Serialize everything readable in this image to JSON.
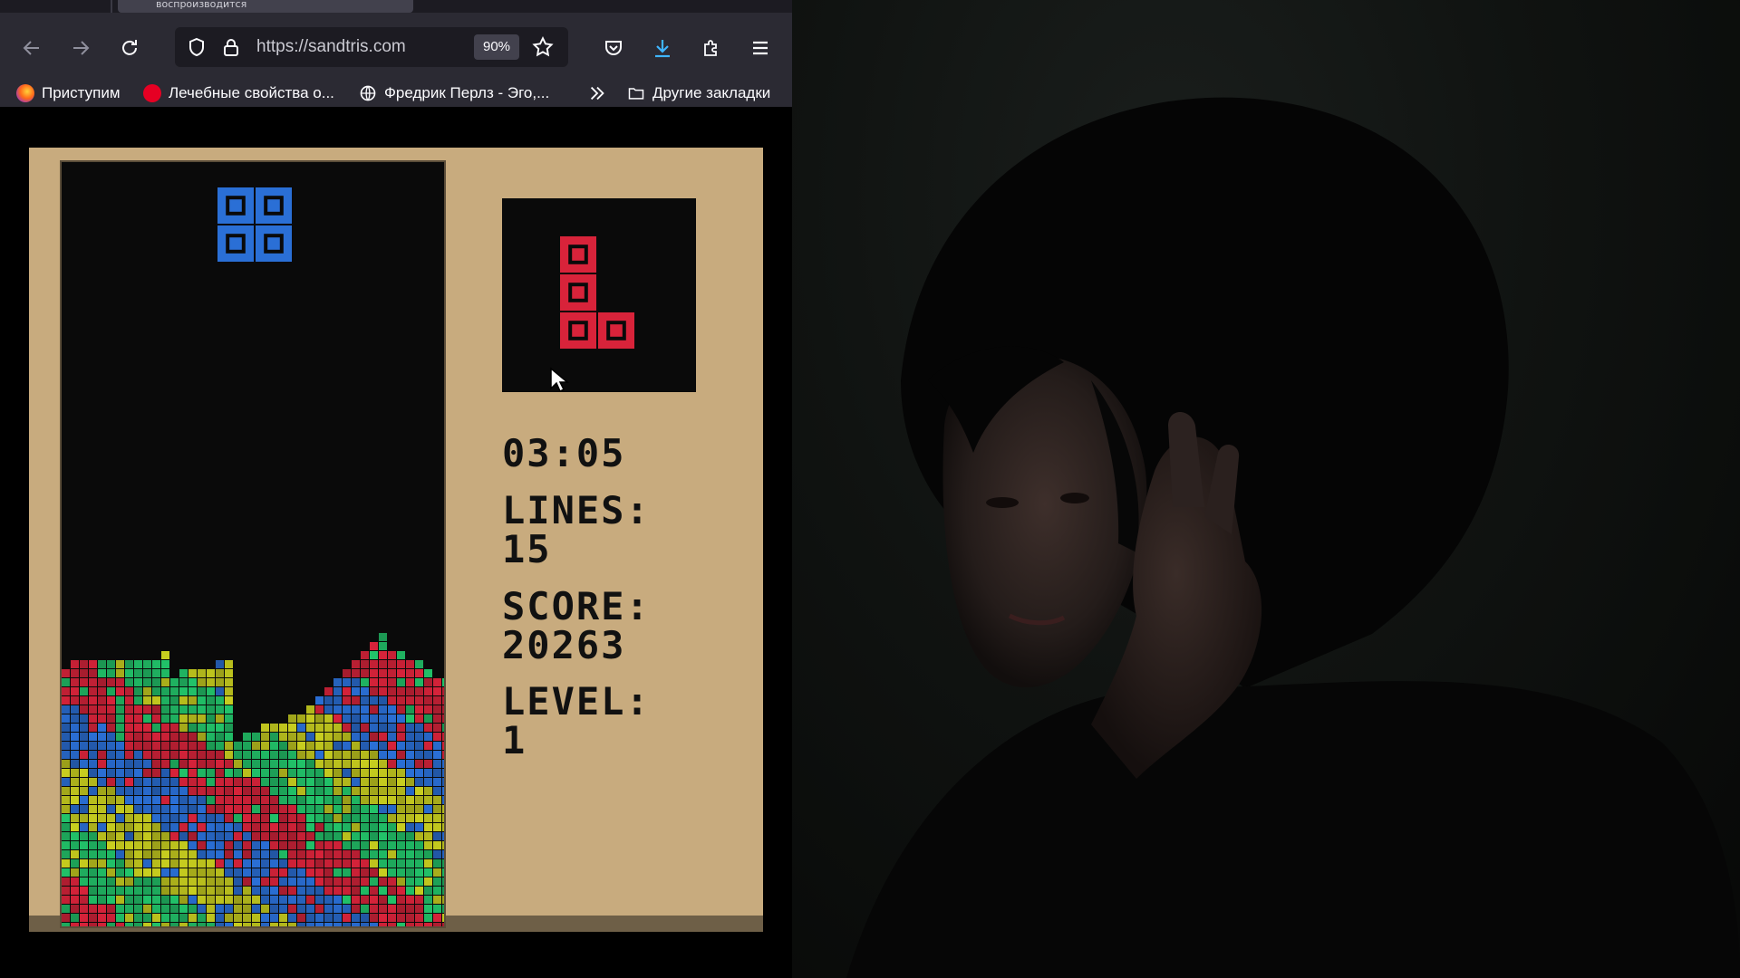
{
  "browser": {
    "tab_title": "воспроизводится",
    "url": "https://sandtris.com",
    "zoom": "90%",
    "bookmarks": [
      {
        "label": "Приступим",
        "icon": "firefox-icon"
      },
      {
        "label": "Лечебные свойства о...",
        "icon": "pinterest-icon"
      },
      {
        "label": "Фредрик Перлз - Эго,...",
        "icon": "globe-icon"
      }
    ],
    "other_bookmarks": "Другие закладки"
  },
  "game": {
    "time": "03:05",
    "lines_label": "LINES:",
    "lines_value": "15",
    "score_label": "SCORE:",
    "score_value": "20263",
    "level_label": "LEVEL:",
    "level_value": "1",
    "current_piece": {
      "shape": "O",
      "color": "#2a6fd6"
    },
    "next_piece": {
      "shape": "L",
      "color": "#d8233a"
    },
    "sand_colors": [
      "#d8233a",
      "#22c46a",
      "#c9cf1f",
      "#2a6fd6"
    ]
  },
  "webcam": {
    "description_icon": "webcam-feed-icon"
  }
}
